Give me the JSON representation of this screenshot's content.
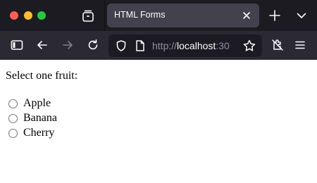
{
  "browser": {
    "tab": {
      "title": "HTML Forms"
    },
    "url": {
      "scheme": "http://",
      "host": "localhost",
      "port": ":30"
    }
  },
  "page": {
    "prompt": "Select one fruit:",
    "options": [
      {
        "label": "Apple",
        "checked": false
      },
      {
        "label": "Banana",
        "checked": false
      },
      {
        "label": "Cherry",
        "checked": false
      }
    ]
  },
  "icons": [
    "tab-list-icon",
    "close-icon",
    "plus-icon",
    "chevron-down-icon",
    "sidebar-icon",
    "back-arrow-icon",
    "forward-arrow-icon",
    "reload-icon",
    "shield-icon",
    "page-icon",
    "star-icon",
    "extensions-icon",
    "menu-icon"
  ]
}
